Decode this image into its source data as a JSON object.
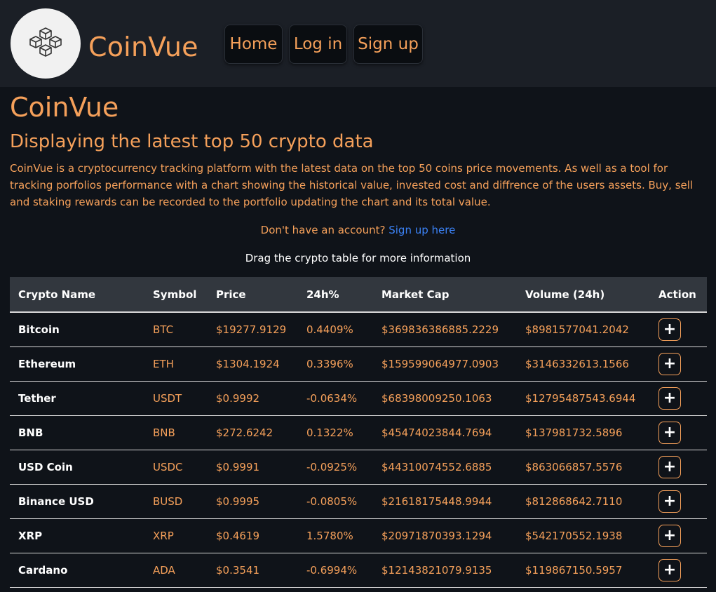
{
  "nav": {
    "brand": "CoinVue",
    "home_label": "Home",
    "login_label": "Log in",
    "signup_label": "Sign up"
  },
  "hero": {
    "title": "CoinVue",
    "subtitle": "Displaying the latest top 50 crypto data",
    "description": "CoinVue is a cryptocurrency tracking platform with the latest data on the top 50 coins price movements. As well as a tool for tracking porfolios performance with a chart showing the historical value, invested cost and diffrence of the users assets. Buy, sell and staking rewards can be recorded to the portfolio updating the chart and its total value.",
    "signup_prompt": "Don't have an account?",
    "signup_link": "Sign up here",
    "drag_hint": "Drag the crypto table for more information"
  },
  "table": {
    "headers": [
      "Crypto Name",
      "Symbol",
      "Price",
      "24h%",
      "Market Cap",
      "Volume (24h)",
      "Action"
    ],
    "action_label": "+",
    "rows": [
      {
        "name": "Bitcoin",
        "symbol": "BTC",
        "price": "$19277.9129",
        "change": "0.4409%",
        "market_cap": "$369836386885.2229",
        "volume": "$8981577041.2042"
      },
      {
        "name": "Ethereum",
        "symbol": "ETH",
        "price": "$1304.1924",
        "change": "0.3396%",
        "market_cap": "$159599064977.0903",
        "volume": "$3146332613.1566"
      },
      {
        "name": "Tether",
        "symbol": "USDT",
        "price": "$0.9992",
        "change": "-0.0634%",
        "market_cap": "$68398009250.1063",
        "volume": "$12795487543.6944"
      },
      {
        "name": "BNB",
        "symbol": "BNB",
        "price": "$272.6242",
        "change": "0.1322%",
        "market_cap": "$45474023844.7694",
        "volume": "$137981732.5896"
      },
      {
        "name": "USD Coin",
        "symbol": "USDC",
        "price": "$0.9991",
        "change": "-0.0925%",
        "market_cap": "$44310074552.6885",
        "volume": "$863066857.5576"
      },
      {
        "name": "Binance USD",
        "symbol": "BUSD",
        "price": "$0.9995",
        "change": "-0.0805%",
        "market_cap": "$21618175448.9944",
        "volume": "$812868642.7110"
      },
      {
        "name": "XRP",
        "symbol": "XRP",
        "price": "$0.4619",
        "change": "1.5780%",
        "market_cap": "$20971870393.1294",
        "volume": "$542170552.1938"
      },
      {
        "name": "Cardano",
        "symbol": "ADA",
        "price": "$0.3541",
        "change": "-0.6994%",
        "market_cap": "$12143821079.9135",
        "volume": "$119867150.5957"
      }
    ]
  },
  "colors": {
    "accent": "#f5a05a",
    "link": "#3b82f6",
    "background": "#0f1319",
    "navbar": "#1b1f26",
    "table_header": "#32373e"
  },
  "icons": {
    "logo": "blocks-cube-icon",
    "add": "plus-icon"
  }
}
